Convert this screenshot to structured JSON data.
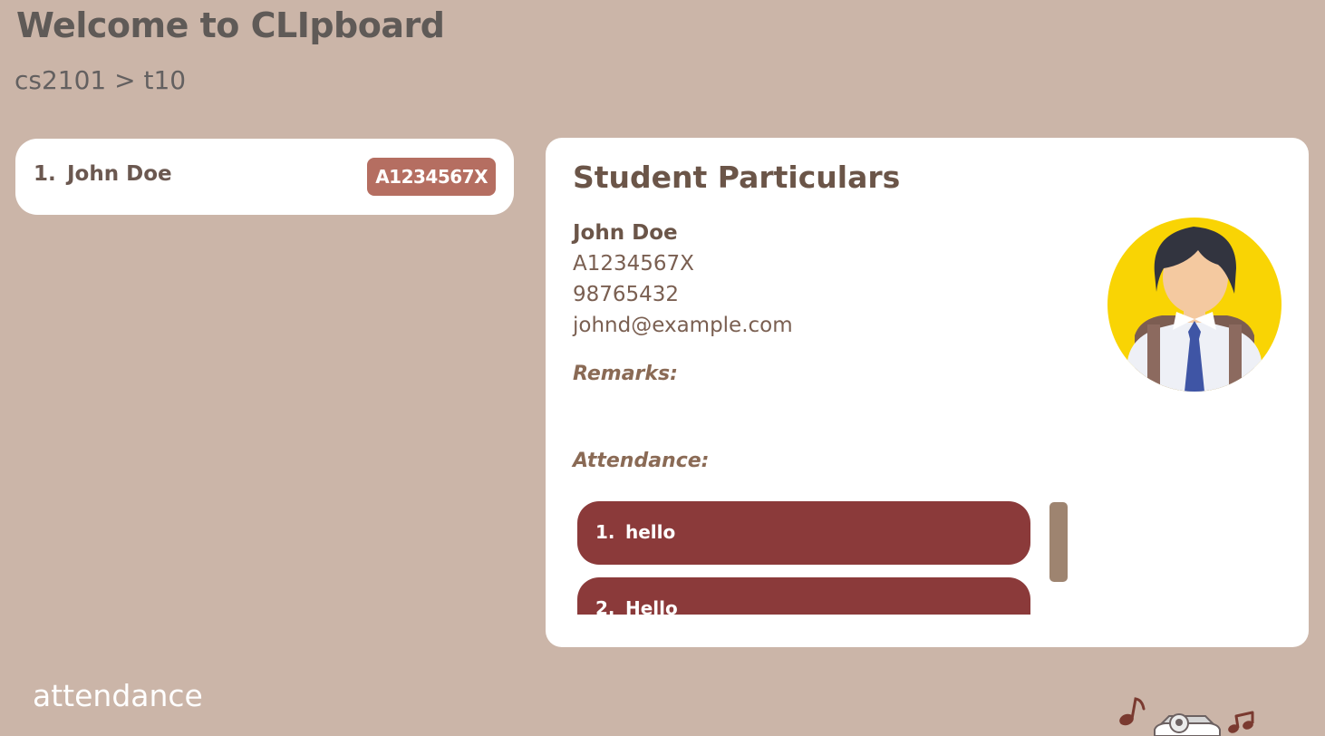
{
  "header": {
    "welcome": "Welcome to CLIpboard",
    "breadcrumb": "cs2101 > t10"
  },
  "student_list": {
    "items": [
      {
        "index": "1.",
        "name": "John Doe",
        "id": "A1234567X"
      }
    ]
  },
  "student_particulars": {
    "title": "Student Particulars",
    "name": "John Doe",
    "student_id": "A1234567X",
    "phone": "98765432",
    "email": "johnd@example.com",
    "remarks_label": "Remarks:",
    "attendance_label": "Attendance:",
    "attendance": [
      {
        "index": "1.",
        "text": "hello"
      },
      {
        "index": "2.",
        "text": "Hello"
      }
    ]
  },
  "command_box": {
    "text": "attendance"
  },
  "colors": {
    "background": "#cbb5a8",
    "panel": "#ffffff",
    "badge": "#b56e61",
    "attendance_item": "#8b3a3a",
    "avatar_circle": "#f9d404"
  },
  "icons": {
    "avatar": "student-avatar-icon",
    "mascot": "clipboard-music-icon"
  }
}
